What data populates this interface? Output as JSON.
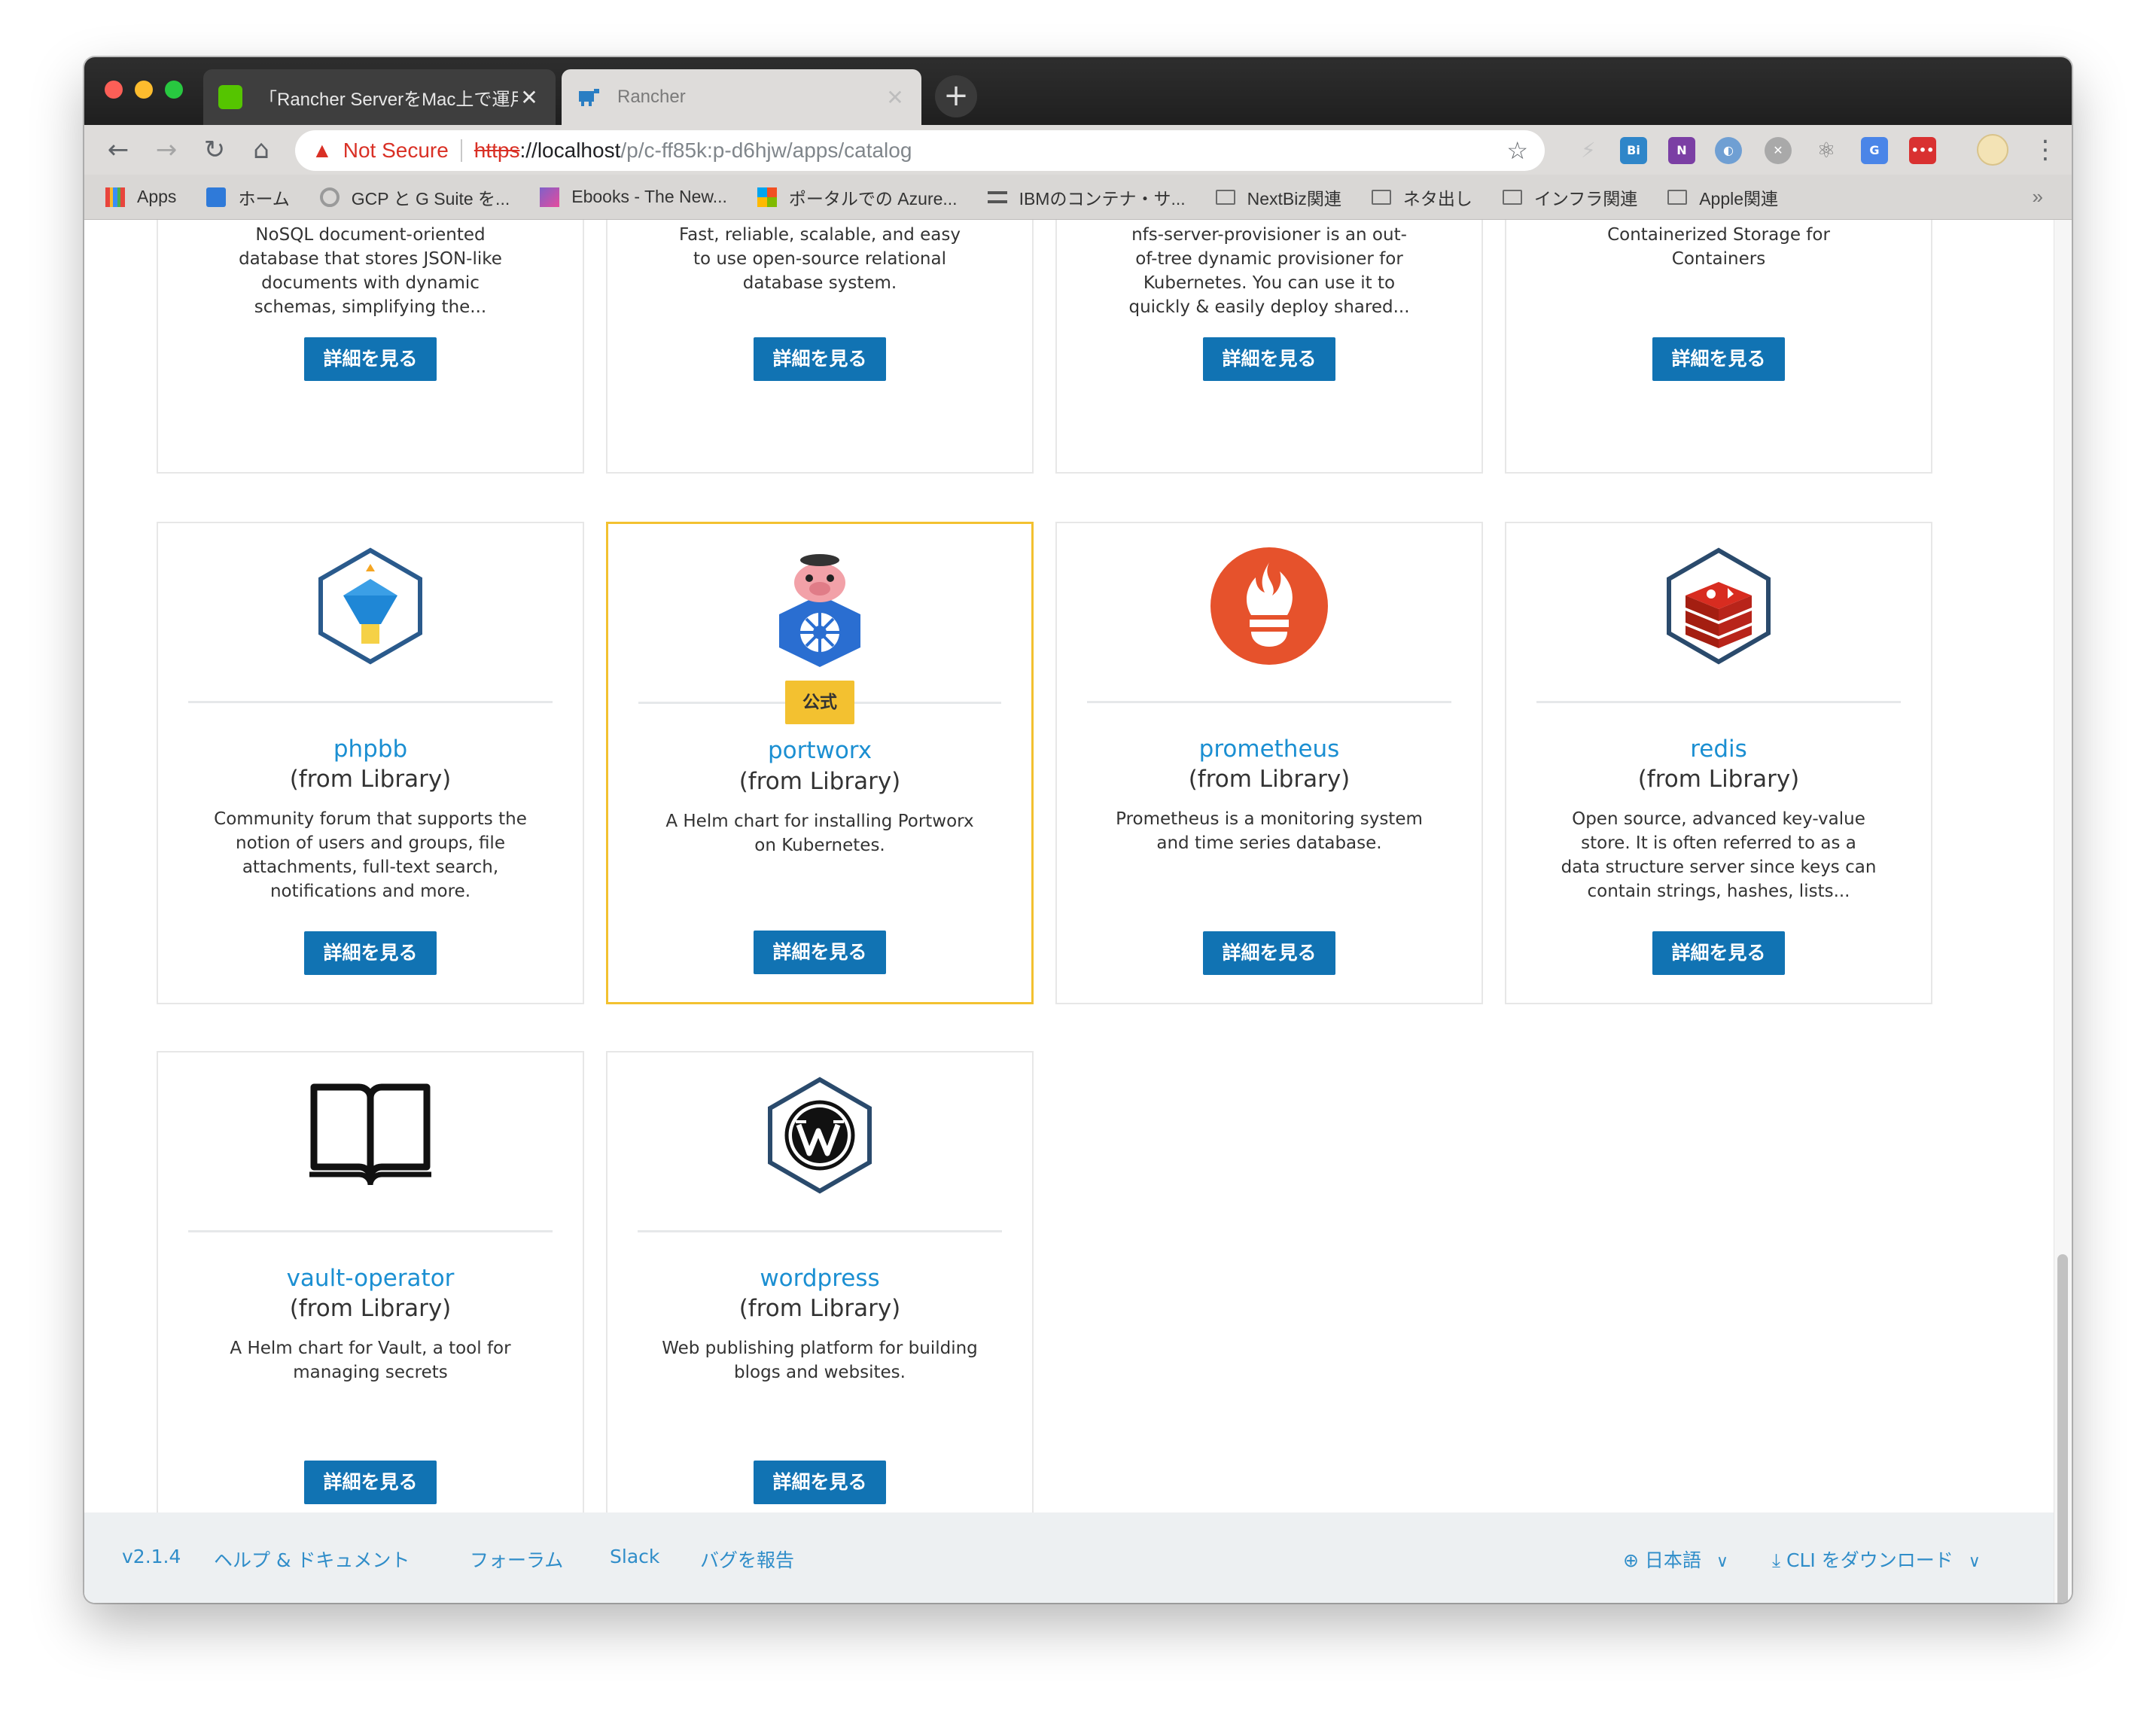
{
  "browser": {
    "tabs": [
      {
        "title": "「Rancher ServerをMac上で運用",
        "active": false
      },
      {
        "title": "Rancher",
        "active": true
      }
    ],
    "close_glyph": "✕",
    "new_tab_glyph": "+",
    "security_label": "Not Secure",
    "url_scheme": "https",
    "url_host": "://localhost",
    "url_path": "/p/c-ff85k:p-d6hjw/apps/catalog",
    "bookmarks": [
      {
        "label": "Apps",
        "icon": "apps-grid-icon"
      },
      {
        "label": "ホーム",
        "icon": "home-icon"
      },
      {
        "label": "GCP と G Suite を...",
        "icon": "gcp-icon"
      },
      {
        "label": "Ebooks - The New...",
        "icon": "ebooks-icon"
      },
      {
        "label": "ポータルでの Azure...",
        "icon": "microsoft-icon"
      },
      {
        "label": "IBMのコンテナ・サ...",
        "icon": "ibm-icon"
      },
      {
        "label": "NextBiz関連",
        "icon": "folder-icon"
      },
      {
        "label": "ネタ出し",
        "icon": "folder-icon"
      },
      {
        "label": "インフラ関連",
        "icon": "folder-icon"
      },
      {
        "label": "Apple関連",
        "icon": "folder-icon"
      }
    ],
    "bookmarks_overflow": "»"
  },
  "catalog": {
    "button_label": "詳細を見る",
    "official_badge": "公式",
    "top_row": [
      {
        "desc_lines": [
          "NoSQL document-oriented",
          "database that stores JSON-like",
          "documents with dynamic",
          "schemas, simplifying the..."
        ]
      },
      {
        "desc_lines": [
          "Fast, reliable, scalable, and easy",
          "to use open-source relational",
          "database system."
        ]
      },
      {
        "desc_lines": [
          "nfs-server-provisioner is an out-",
          "of-tree dynamic provisioner for",
          "Kubernetes. You can use it to",
          "quickly & easily deploy shared..."
        ]
      },
      {
        "desc_lines": [
          "Containerized Storage for",
          "Containers"
        ]
      }
    ],
    "apps": [
      {
        "name": "phpbb",
        "source": "(from Library)",
        "description": "Community forum that supports the notion of users and groups, file attachments, full-text search, notifications and more.",
        "icon": "phpbb-icon"
      },
      {
        "name": "portworx",
        "source": "(from Library)",
        "description": "A Helm chart for installing Portworx on Kubernetes.",
        "icon": "portworx-icon",
        "official": true
      },
      {
        "name": "prometheus",
        "source": "(from Library)",
        "description": "Prometheus is a monitoring system and time series database.",
        "icon": "prometheus-icon"
      },
      {
        "name": "redis",
        "source": "(from Library)",
        "description": "Open source, advanced key-value store. It is often referred to as a data structure server since keys can contain strings, hashes, lists...",
        "icon": "redis-icon"
      },
      {
        "name": "vault-operator",
        "source": "(from Library)",
        "description": "A Helm chart for Vault, a tool for managing secrets",
        "icon": "book-icon"
      },
      {
        "name": "wordpress",
        "source": "(from Library)",
        "description": "Web publishing platform for building blogs and websites.",
        "icon": "wordpress-icon"
      }
    ]
  },
  "footer": {
    "version": "v2.1.4",
    "help": "ヘルプ & ドキュメント",
    "forum": "フォーラム",
    "slack": "Slack",
    "bug": "バグを報告",
    "language": "日本語",
    "cli": "CLI をダウンロード"
  },
  "colors": {
    "link": "#1b8fd2",
    "button": "#1173b3",
    "badge": "#f3c130",
    "not_secure": "#d93025"
  }
}
